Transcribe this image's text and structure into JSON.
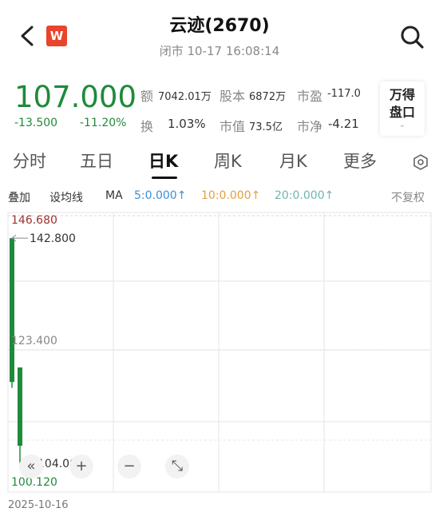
{
  "header": {
    "title": "云迹(2670)",
    "subtitle": "闭市 10-17 16:08:14",
    "logo_text": "W"
  },
  "quote": {
    "price": "107.000",
    "change": "-13.500",
    "change_pct": "-11.20%",
    "turnover_label": "额",
    "turnover_value": "7042.01万",
    "shares_label": "股本",
    "shares_value": "6872万",
    "pe_label": "市盈",
    "pe_value": "-117.0",
    "turnover_rate_label": "换",
    "turnover_rate_value": "1.03%",
    "mktcap_label": "市值",
    "mktcap_value": "73.5亿",
    "pb_label": "市净",
    "pb_value": "-4.21",
    "wande_line1": "万得",
    "wande_line2": "盘口"
  },
  "tabs": [
    {
      "label": "分时"
    },
    {
      "label": "五日"
    },
    {
      "label": "日K"
    },
    {
      "label": "周K"
    },
    {
      "label": "月K"
    },
    {
      "label": "更多"
    }
  ],
  "ma_bar": {
    "overlay": "叠加",
    "set_ma": "设均线",
    "ma": "MA",
    "ma5": "5:0.000↑",
    "ma10": "10:0.000↑",
    "ma20": "20:0.000↑",
    "adjust": "不复权"
  },
  "chart_data": {
    "type": "candlestick",
    "y_top_label": "146.680",
    "y_mid_label": "123.400",
    "y_bottom_label": "100.120",
    "high_marker": "142.800",
    "low_marker": "104.000",
    "ylim": [
      100.12,
      146.68
    ],
    "candles": [
      {
        "open": 142.8,
        "close": 118.0,
        "high": 142.8,
        "low": 117.0
      },
      {
        "open": 120.5,
        "close": 107.0,
        "high": 120.5,
        "low": 104.0
      }
    ],
    "x_date": "2025-10-16"
  },
  "colors": {
    "down": "#1f8a3a",
    "ma5": "#3a8fd6",
    "ma10": "#e0a040",
    "ma20": "#6fb5b0",
    "top_label": "#a03030"
  }
}
